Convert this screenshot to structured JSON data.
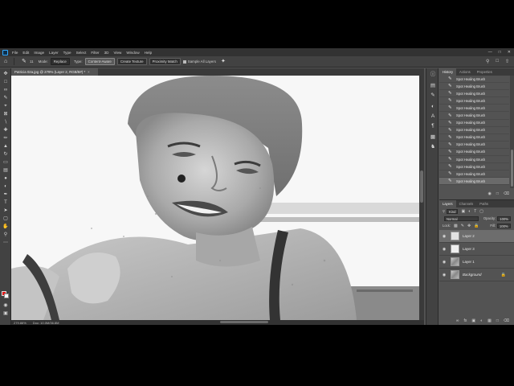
{
  "menu": {
    "items": [
      "File",
      "Edit",
      "Image",
      "Layer",
      "Type",
      "Select",
      "Filter",
      "3D",
      "View",
      "Window",
      "Help"
    ],
    "window_controls": [
      "—",
      "□",
      "✕"
    ]
  },
  "options": {
    "brush_size": "11",
    "mode_label": "Mode:",
    "mode_value": "Replace",
    "type_label": "Type:",
    "type_buttons": [
      "Content-Aware",
      "Create Texture",
      "Proximity Match"
    ],
    "active_type": "Content-Aware",
    "sample_all_layers": "Sample All Layers",
    "sample_all_checked": true
  },
  "document": {
    "tab_title": "Patricia 02a.jpg @ 279% (Layer 2, RGB/8#) *",
    "zoom": "279.86%",
    "doc_info": "Doc: 10.0M/36.8M"
  },
  "colors": {
    "foreground": "#e31b1b",
    "background": "#ffffff",
    "accent": "#31a8ff"
  },
  "history": {
    "tabs": [
      "History",
      "Actions",
      "Properties"
    ],
    "active_tab": "History",
    "items": [
      "Spot Healing Brush",
      "Spot Healing Brush",
      "Spot Healing Brush",
      "Spot Healing Brush",
      "Spot Healing Brush",
      "Spot Healing Brush",
      "Spot Healing Brush",
      "Spot Healing Brush",
      "Spot Healing Brush",
      "Spot Healing Brush",
      "Spot Healing Brush",
      "Spot Healing Brush",
      "Spot Healing Brush",
      "Spot Healing Brush",
      "Spot Healing Brush"
    ]
  },
  "layers": {
    "tabs": [
      "Layers",
      "Channels",
      "Paths"
    ],
    "active_tab": "Layers",
    "filter_kind": "Kind",
    "blend_mode": "Normal",
    "opacity_label": "Opacity:",
    "opacity_value": "100%",
    "lock_label": "Lock:",
    "fill_label": "Fill:",
    "fill_value": "100%",
    "items": [
      {
        "name": "Layer 2",
        "selected": true,
        "locked": false
      },
      {
        "name": "Layer 3",
        "selected": false,
        "locked": false
      },
      {
        "name": "Layer 1",
        "selected": false,
        "locked": false
      },
      {
        "name": "Background",
        "selected": false,
        "locked": true
      }
    ]
  }
}
